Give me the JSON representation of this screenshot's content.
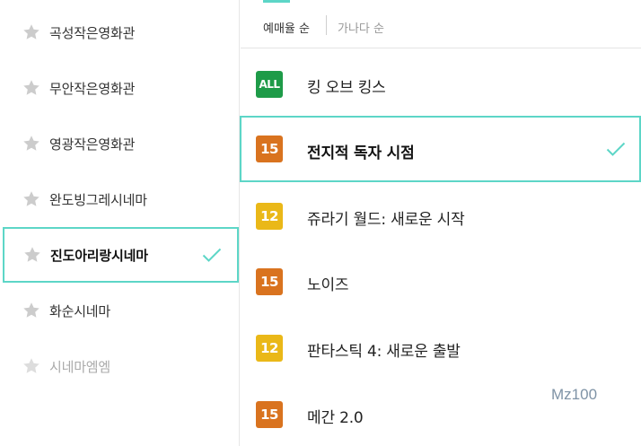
{
  "theaters": [
    {
      "name": "곡성작은영화관",
      "selected": false,
      "disabled": false
    },
    {
      "name": "무안작은영화관",
      "selected": false,
      "disabled": false
    },
    {
      "name": "영광작은영화관",
      "selected": false,
      "disabled": false
    },
    {
      "name": "완도빙그레시네마",
      "selected": false,
      "disabled": false
    },
    {
      "name": "진도아리랑시네마",
      "selected": true,
      "disabled": false
    },
    {
      "name": "화순시네마",
      "selected": false,
      "disabled": false
    },
    {
      "name": "시네마엠엠",
      "selected": false,
      "disabled": true
    }
  ],
  "sort": {
    "active": "예매율 순",
    "inactive": "가나다 순"
  },
  "movies": [
    {
      "rating": "ALL",
      "rating_class": "all",
      "title": "킹 오브 킹스",
      "selected": false
    },
    {
      "rating": "15",
      "rating_class": "r15",
      "title": "전지적 독자 시점",
      "selected": true
    },
    {
      "rating": "12",
      "rating_class": "r12",
      "title": "쥬라기 월드: 새로운 시작",
      "selected": false
    },
    {
      "rating": "15",
      "rating_class": "r15",
      "title": "노이즈",
      "selected": false
    },
    {
      "rating": "12",
      "rating_class": "r12",
      "title": "판타스틱 4: 새로운 출발",
      "selected": false
    },
    {
      "rating": "15",
      "rating_class": "r15",
      "title": "메간 2.0",
      "selected": false
    }
  ],
  "watermark": "Mz100",
  "colors": {
    "accent": "#5dd6c7",
    "rating_all": "#1e9b48",
    "rating_15": "#d9731f",
    "rating_12": "#eab818",
    "star": "#cccccc"
  }
}
